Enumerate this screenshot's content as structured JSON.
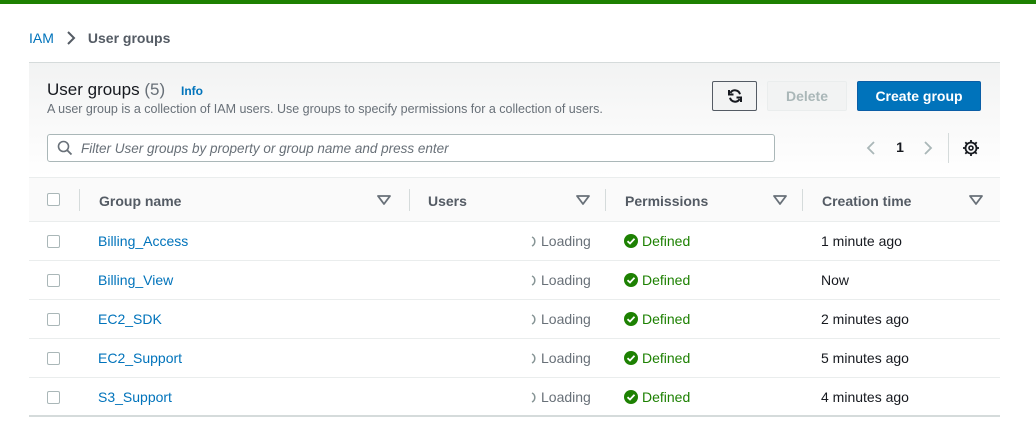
{
  "breadcrumb": {
    "root": "IAM",
    "current": "User groups"
  },
  "header": {
    "title": "User groups",
    "count": "(5)",
    "info": "Info",
    "description": "A user group is a collection of IAM users. Use groups to specify permissions for a collection of users."
  },
  "actions": {
    "refresh_icon": "refresh-icon",
    "delete": "Delete",
    "create": "Create group"
  },
  "search": {
    "placeholder": "Filter User groups by property or group name and press enter",
    "value": ""
  },
  "pagination": {
    "current_page": "1"
  },
  "table": {
    "columns": [
      "Group name",
      "Users",
      "Permissions",
      "Creation time"
    ],
    "rows": [
      {
        "name": "Billing_Access",
        "users": "Loading",
        "permissions": "Defined",
        "created": "1 minute ago"
      },
      {
        "name": "Billing_View",
        "users": "Loading",
        "permissions": "Defined",
        "created": "Now"
      },
      {
        "name": "EC2_SDK",
        "users": "Loading",
        "permissions": "Defined",
        "created": "2 minutes ago"
      },
      {
        "name": "EC2_Support",
        "users": "Loading",
        "permissions": "Defined",
        "created": "5 minutes ago"
      },
      {
        "name": "S3_Support",
        "users": "Loading",
        "permissions": "Defined",
        "created": "4 minutes ago"
      }
    ]
  },
  "colors": {
    "accent": "#0073bb",
    "top_bar": "#1d8102",
    "success": "#1d8102"
  }
}
